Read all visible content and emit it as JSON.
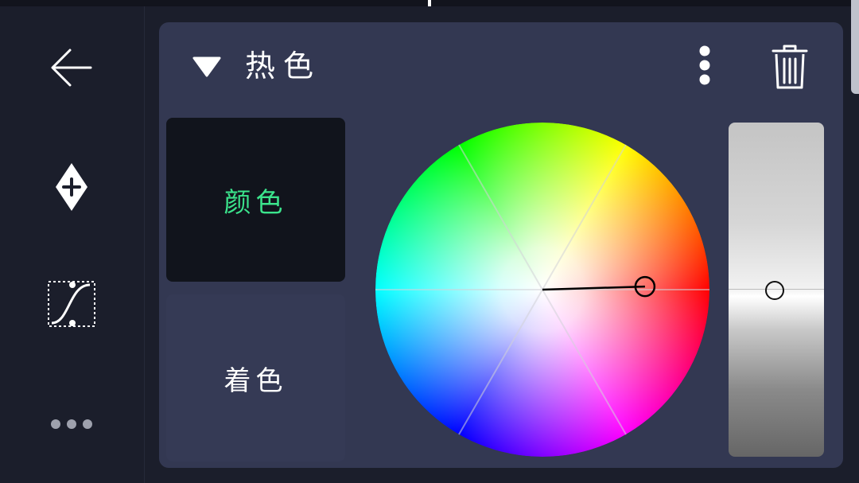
{
  "header": {
    "title": "热色"
  },
  "modes": {
    "active_label": "颜色",
    "inactive_label": "着色"
  },
  "colors": {
    "active_tab_text": "#3be48c",
    "panel_bg": "#333852",
    "app_bg": "#1b1e2b"
  },
  "icons": {
    "back": "back-arrow-icon",
    "add_keyframe": "add-keyframe-icon",
    "curve": "curve-icon",
    "more_rail": "more-horizontal-icon",
    "collapse": "triangle-down-icon",
    "more_header": "more-vertical-icon",
    "trash": "trash-icon"
  },
  "color_picker": {
    "hue_degrees": 0,
    "saturation": 0.62,
    "value": 0.5
  }
}
